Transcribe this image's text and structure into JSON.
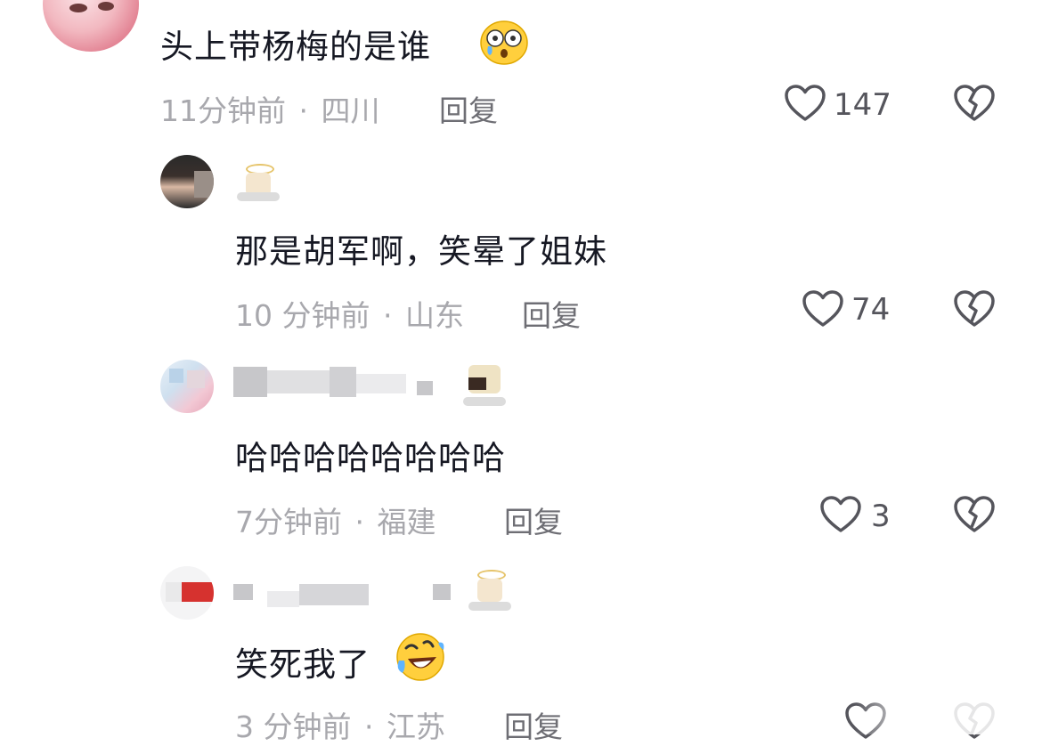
{
  "comments": [
    {
      "text": "头上带杨梅的是谁",
      "time": "11分钟前",
      "sep": "·",
      "location": "四川",
      "reply_label": "回复",
      "likes": "147",
      "emoji_icon": "scared-tear-emoji-icon"
    },
    {
      "text": "那是胡军啊，笑晕了姐妹",
      "time": "10 分钟前",
      "sep": "·",
      "location": "山东",
      "reply_label": "回复",
      "likes": "74"
    },
    {
      "text": "哈哈哈哈哈哈哈哈",
      "time": "7分钟前",
      "sep": "·",
      "location": "福建",
      "reply_label": "回复",
      "likes": "3"
    },
    {
      "text": "笑死我了",
      "time": "3 分钟前",
      "sep": "·",
      "location": "江苏",
      "reply_label": "回复",
      "likes": "",
      "emoji_icon": "rolling-laughing-emoji-icon"
    }
  ],
  "colors": {
    "text": "#161823",
    "meta": "#a8a8ad",
    "icon": "#55555c"
  }
}
